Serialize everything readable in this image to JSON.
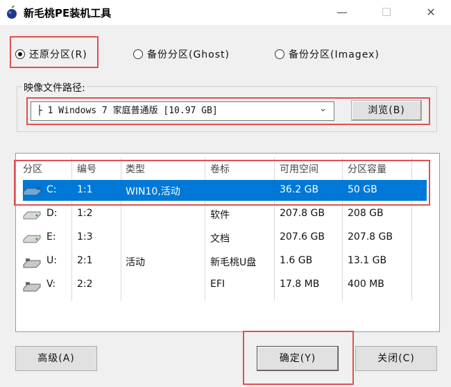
{
  "window": {
    "title": "新毛桃PE装机工具"
  },
  "restore_options": [
    {
      "label": "还原分区(R)",
      "checked": true
    },
    {
      "label": "备份分区(Ghost)",
      "checked": false
    },
    {
      "label": "备份分区(Imagex)",
      "checked": false
    }
  ],
  "image_path": {
    "label": "映像文件路径:",
    "value": "├ 1 Windows 7 家庭普通版 [10.97 GB]",
    "browse_label": "浏览(B)"
  },
  "table": {
    "headers": [
      "分区",
      "编号",
      "类型",
      "卷标",
      "可用空间",
      "分区容量"
    ],
    "rows": [
      {
        "drive": "C:",
        "num": "1:1",
        "type": "WIN10,活动",
        "label": "",
        "free": "36.2 GB",
        "capacity": "50 GB",
        "selected": true,
        "icon": "usb-drive-icon"
      },
      {
        "drive": "D:",
        "num": "1:2",
        "type": "",
        "label": "软件",
        "free": "207.8 GB",
        "capacity": "208 GB",
        "selected": false,
        "icon": "hard-drive-icon"
      },
      {
        "drive": "E:",
        "num": "1:3",
        "type": "",
        "label": "文档",
        "free": "207.6 GB",
        "capacity": "207.8 GB",
        "selected": false,
        "icon": "hard-drive-icon"
      },
      {
        "drive": "U:",
        "num": "2:1",
        "type": "活动",
        "label": "新毛桃U盘",
        "free": "1.6 GB",
        "capacity": "13.1 GB",
        "selected": false,
        "icon": "usb-drive-icon"
      },
      {
        "drive": "V:",
        "num": "2:2",
        "type": "",
        "label": "EFI",
        "free": "17.8 MB",
        "capacity": "400 MB",
        "selected": false,
        "icon": "usb-drive-icon"
      }
    ]
  },
  "buttons": {
    "advanced": "高级(A)",
    "confirm": "确定(Y)",
    "close": "关闭(C)"
  },
  "colors": {
    "selection": "#0078d7",
    "highlight_box": "#e05050"
  }
}
